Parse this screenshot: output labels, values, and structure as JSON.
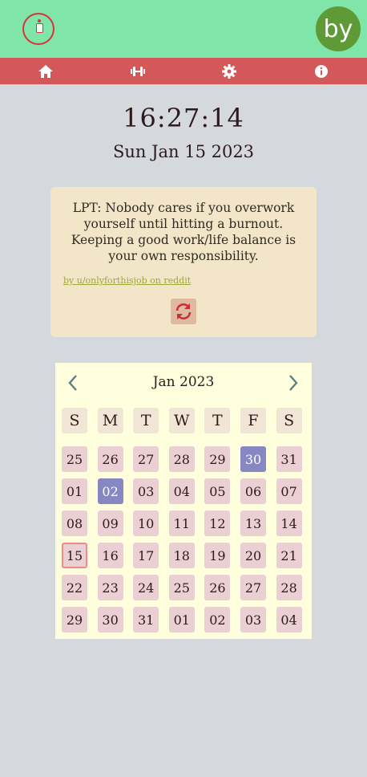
{
  "header": {
    "avatar_text": "by"
  },
  "nav": {
    "items": [
      {
        "icon": "home-icon"
      },
      {
        "icon": "dumbbell-icon"
      },
      {
        "icon": "gear-icon"
      },
      {
        "icon": "info-icon"
      }
    ]
  },
  "clock": {
    "time": "16:27:14",
    "date": "Sun Jan 15 2023"
  },
  "quote": {
    "text": "LPT: Nobody cares if you overwork yourself until hitting a burnout. Keeping a good work/life balance is your own responsibility.",
    "source": "by u/onlyforthisjob on reddit",
    "refresh_icon": "refresh-icon"
  },
  "calendar": {
    "title": "Jan 2023",
    "prev_icon": "chevron-left-icon",
    "next_icon": "chevron-right-icon",
    "weekdays": [
      "S",
      "M",
      "T",
      "W",
      "T",
      "F",
      "S"
    ],
    "weeks": [
      [
        "25",
        "26",
        "27",
        "28",
        "29",
        "30",
        "31"
      ],
      [
        "01",
        "02",
        "03",
        "04",
        "05",
        "06",
        "07"
      ],
      [
        "08",
        "09",
        "10",
        "11",
        "12",
        "13",
        "14"
      ],
      [
        "15",
        "16",
        "17",
        "18",
        "19",
        "20",
        "21"
      ],
      [
        "22",
        "23",
        "24",
        "25",
        "26",
        "27",
        "28"
      ],
      [
        "29",
        "30",
        "31",
        "01",
        "02",
        "03",
        "04"
      ]
    ],
    "marked_days": [
      "0-5",
      "1-1"
    ],
    "today": "3-0"
  },
  "colors": {
    "header_bg": "#80e5a8",
    "nav_bg": "#d4575a",
    "page_bg": "#d5d9de",
    "card_bg": "#f3e6c8",
    "calendar_bg": "#ffffde",
    "marked_day": "#8787c2",
    "today_outline": "#f18a8a",
    "avatar_bg": "#5e9a36"
  }
}
